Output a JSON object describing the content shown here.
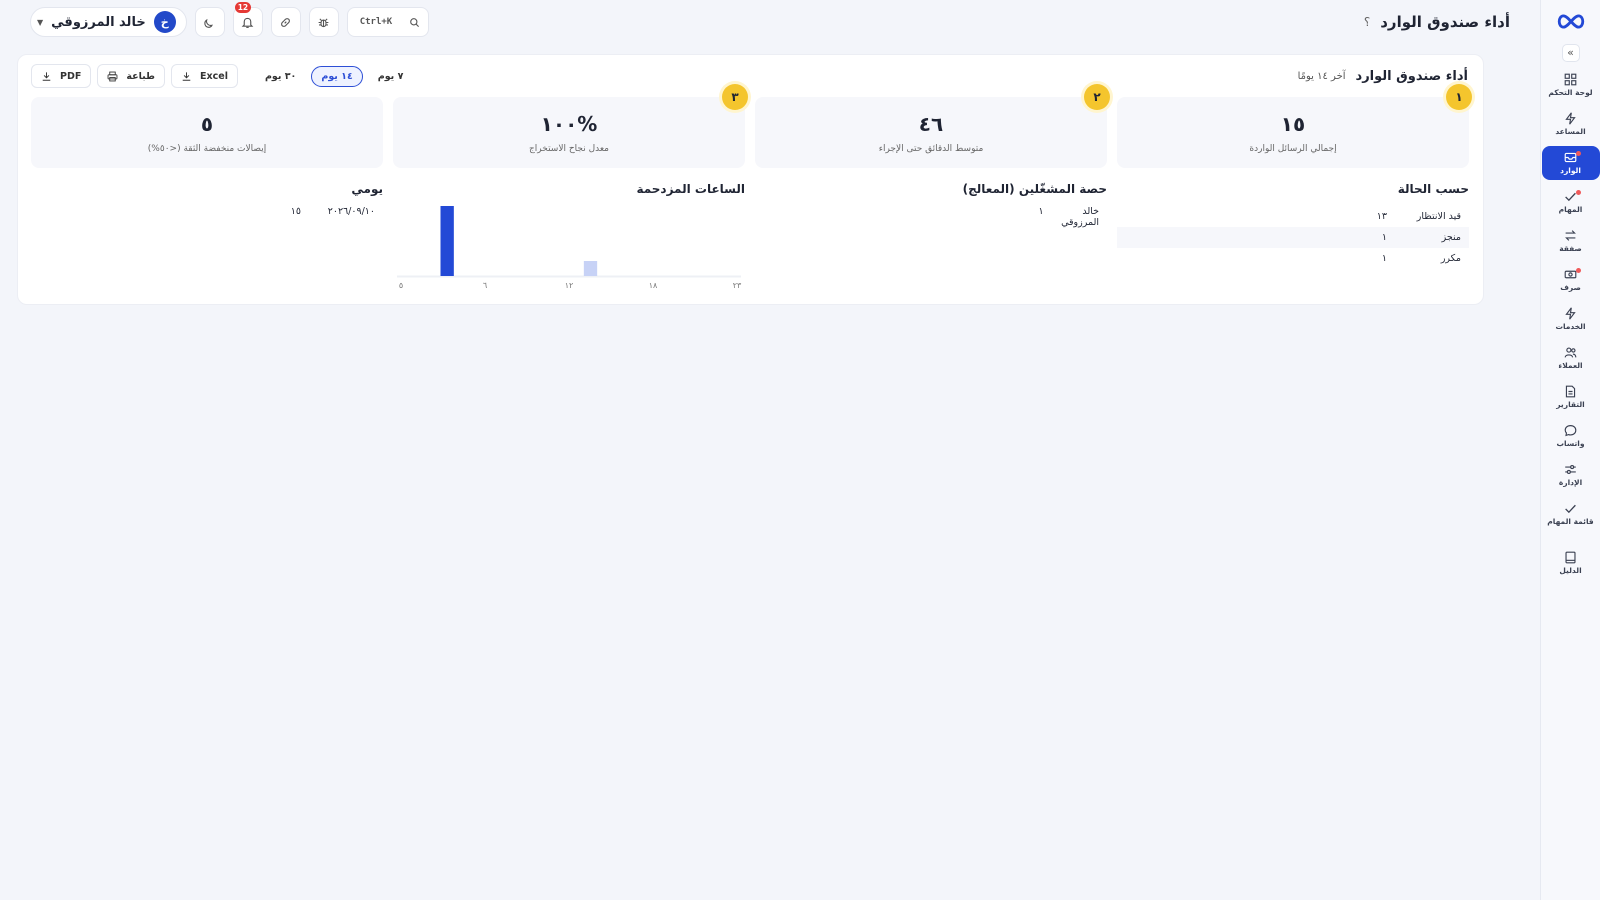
{
  "sidebar": {
    "items": [
      {
        "label": "لوحة التحكم",
        "icon": "dashboard-icon"
      },
      {
        "label": "المساعد",
        "icon": "lightning-icon"
      },
      {
        "label": "الوارد",
        "icon": "inbox-icon",
        "active": true
      },
      {
        "label": "المهام",
        "icon": "check-icon"
      },
      {
        "label": "صفقة",
        "icon": "swap-icon"
      },
      {
        "label": "صرف",
        "icon": "cash-icon"
      },
      {
        "label": "الخدمات",
        "icon": "lightning-icon"
      },
      {
        "label": "العملاء",
        "icon": "users-icon"
      },
      {
        "label": "التقارير",
        "icon": "report-icon"
      },
      {
        "label": "واتساب",
        "icon": "chat-icon"
      },
      {
        "label": "الإدارة",
        "icon": "sliders-icon"
      },
      {
        "label": "قائمة المهام",
        "icon": "check-icon"
      },
      {
        "label": "الدليل",
        "icon": "book-icon"
      }
    ]
  },
  "topbar": {
    "title": "أداء صندوق الوارد",
    "help": "؟",
    "user_name": "خالد المرزوقي",
    "avatar_letter": "خ",
    "notifications": "12",
    "search_shortcut": "Ctrl+K"
  },
  "card": {
    "title": "أداء صندوق الوارد",
    "subtitle": "آخر ١٤ يومًا",
    "ranges": [
      "٧ يوم",
      "١٤ يوم",
      "٣٠ يوم"
    ],
    "active_range": "١٤ يوم",
    "excel": "Excel",
    "print": "طباعة",
    "pdf": "PDF"
  },
  "kpis": [
    {
      "step": "١",
      "value": "١٥",
      "label": "إجمالي الرسائل الواردة"
    },
    {
      "step": "٢",
      "value": "٤٦",
      "label": "متوسط الدقائق حتى الإجراء"
    },
    {
      "step": "٣",
      "value": "١٠٠%",
      "label": "معدل نجاح الاستخراج"
    },
    {
      "value": "٥",
      "label": "إيصالات منخفضة الثقة (<٥٠%)"
    }
  ],
  "status": {
    "title": "حسب الحالة",
    "rows": [
      {
        "name": "قيد الانتظار",
        "value": "١٣"
      },
      {
        "name": "منجز",
        "value": "١"
      },
      {
        "name": "مكرر",
        "value": "١"
      }
    ]
  },
  "operators": {
    "title": "حصة المشغّلين (المعالج)",
    "rows": [
      {
        "name": "خالد المرزوقي",
        "value": "١"
      }
    ]
  },
  "peak_hours": {
    "title": "الساعات المزدحمة"
  },
  "daily": {
    "title": "يومي",
    "rows": [
      {
        "date": "٢٠٢٦/٠٩/١٠",
        "value": "١٥"
      }
    ]
  },
  "chart_data": {
    "type": "bar",
    "title": "الساعات المزدحمة",
    "x": [
      0,
      1,
      2,
      3,
      4,
      5,
      6,
      7,
      8,
      9,
      10,
      11,
      12,
      13,
      14,
      15,
      16,
      17,
      18,
      19,
      20,
      21,
      22,
      23
    ],
    "values": [
      0,
      0,
      0,
      14,
      0,
      0,
      0,
      0,
      0,
      0,
      0,
      0,
      0,
      3,
      0,
      0,
      0,
      0,
      0,
      0,
      0,
      0,
      0,
      0
    ],
    "highlight": 3,
    "tick_labels": [
      "٢٣",
      "١٨",
      "١٢",
      "٦",
      "٥"
    ],
    "ylim": [
      0,
      14
    ],
    "colors": {
      "primary": "#2349d6",
      "secondary": "#c7d2f6"
    }
  },
  "colors": {
    "accent": "#2349d6",
    "step": "#f4c52d",
    "badge": "#e53935"
  }
}
